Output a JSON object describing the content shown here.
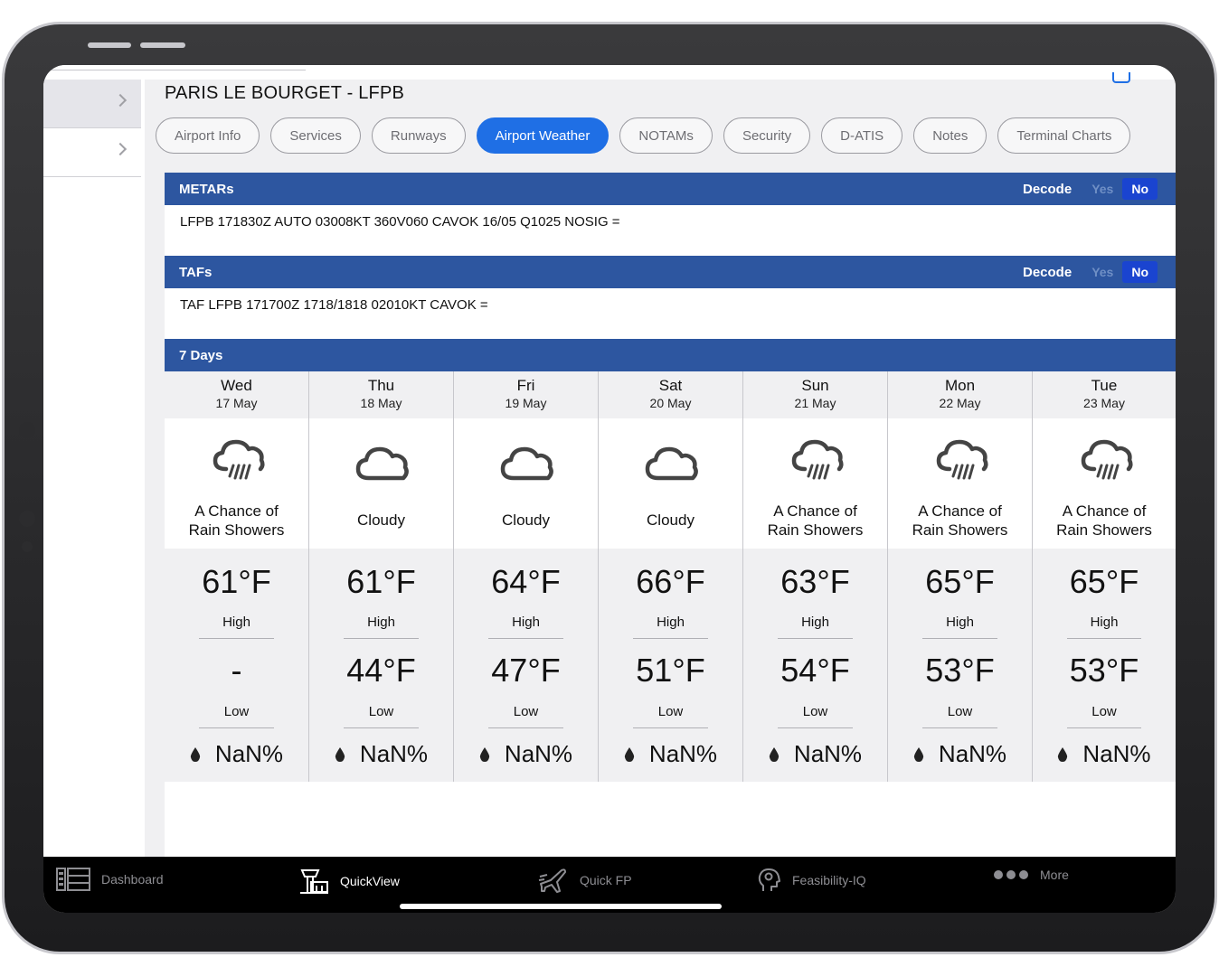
{
  "airport": {
    "title": "PARIS LE BOURGET - LFPB"
  },
  "tabs": [
    {
      "label": "Airport Info",
      "active": false
    },
    {
      "label": "Services",
      "active": false
    },
    {
      "label": "Runways",
      "active": false
    },
    {
      "label": "Airport Weather",
      "active": true
    },
    {
      "label": "NOTAMs",
      "active": false
    },
    {
      "label": "Security",
      "active": false
    },
    {
      "label": "D-ATIS",
      "active": false
    },
    {
      "label": "Notes",
      "active": false
    },
    {
      "label": "Terminal Charts",
      "active": false
    }
  ],
  "metars": {
    "header": "METARs",
    "decode_label": "Decode",
    "yes": "Yes",
    "no": "No",
    "text": "LFPB 171830Z AUTO 03008KT 360V060 CAVOK 16/05 Q1025 NOSIG ="
  },
  "tafs": {
    "header": "TAFs",
    "decode_label": "Decode",
    "yes": "Yes",
    "no": "No",
    "text": "TAF LFPB 171700Z 1718/1818 02010KT CAVOK ="
  },
  "forecast": {
    "header": "7 Days",
    "days": [
      {
        "day": "Wed",
        "date": "17 May",
        "icon": "rain-showers-icon",
        "cond1": "A Chance of",
        "cond2": "Rain Showers",
        "high": "61°F",
        "high_label": "High",
        "low": "-",
        "low_label": "Low",
        "precip": "NaN%"
      },
      {
        "day": "Thu",
        "date": "18 May",
        "icon": "cloud-icon",
        "cond1": "Cloudy",
        "cond2": "",
        "high": "61°F",
        "high_label": "High",
        "low": "44°F",
        "low_label": "Low",
        "precip": "NaN%"
      },
      {
        "day": "Fri",
        "date": "19 May",
        "icon": "cloud-icon",
        "cond1": "Cloudy",
        "cond2": "",
        "high": "64°F",
        "high_label": "High",
        "low": "47°F",
        "low_label": "Low",
        "precip": "NaN%"
      },
      {
        "day": "Sat",
        "date": "20 May",
        "icon": "cloud-icon",
        "cond1": "Cloudy",
        "cond2": "",
        "high": "66°F",
        "high_label": "High",
        "low": "51°F",
        "low_label": "Low",
        "precip": "NaN%"
      },
      {
        "day": "Sun",
        "date": "21 May",
        "icon": "rain-showers-icon",
        "cond1": "A Chance of",
        "cond2": "Rain Showers",
        "high": "63°F",
        "high_label": "High",
        "low": "54°F",
        "low_label": "Low",
        "precip": "NaN%"
      },
      {
        "day": "Mon",
        "date": "22 May",
        "icon": "rain-showers-icon",
        "cond1": "A Chance of",
        "cond2": "Rain Showers",
        "high": "65°F",
        "high_label": "High",
        "low": "53°F",
        "low_label": "Low",
        "precip": "NaN%"
      },
      {
        "day": "Tue",
        "date": "23 May",
        "icon": "rain-showers-icon",
        "cond1": "A Chance of",
        "cond2": "Rain Showers",
        "high": "65°F",
        "high_label": "High",
        "low": "53°F",
        "low_label": "Low",
        "precip": "NaN%"
      }
    ]
  },
  "tabbar": {
    "items": [
      {
        "label": "Dashboard",
        "icon": "dashboard-icon",
        "active": false
      },
      {
        "label": "QuickView",
        "icon": "control-tower-icon",
        "active": true
      },
      {
        "label": "Quick FP",
        "icon": "airplane-icon",
        "active": false
      },
      {
        "label": "Feasibility-IQ",
        "icon": "head-gear-icon",
        "active": false
      },
      {
        "label": "More",
        "icon": "more-dots-icon",
        "active": false
      }
    ]
  },
  "colors": {
    "header_blue": "#2d56a0",
    "active_tab": "#1f6fe5",
    "seg_active": "#1a44d0"
  }
}
